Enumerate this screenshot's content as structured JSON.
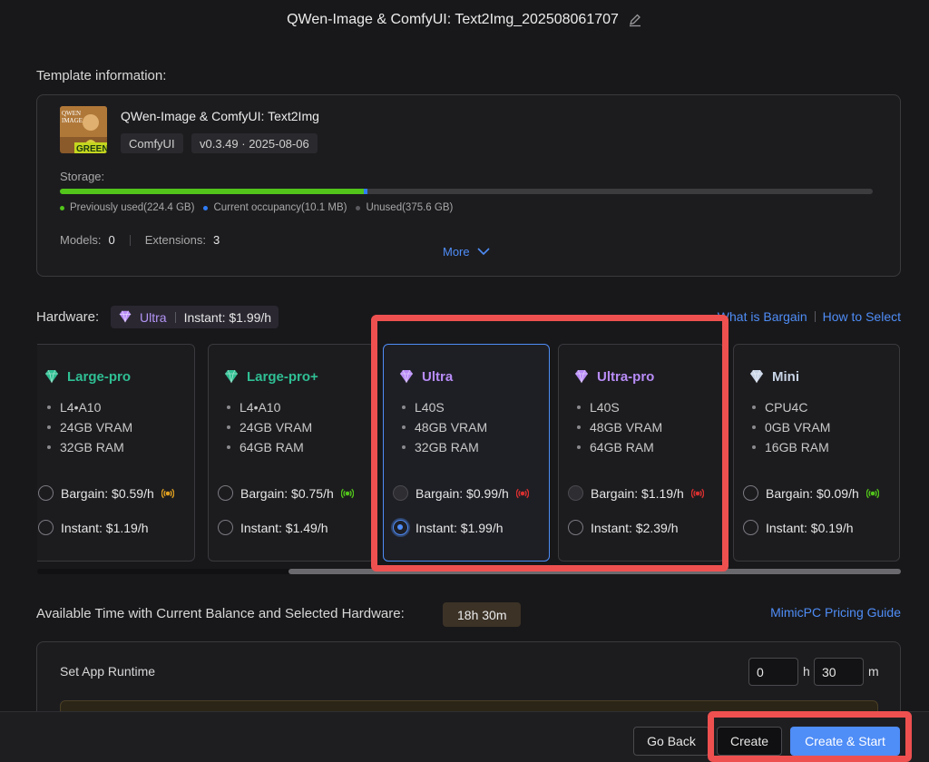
{
  "header": {
    "title": "QWen-Image & ComfyUI: Text2Img_202508061707",
    "edit_icon": "pencil-icon"
  },
  "template": {
    "label": "Template information:",
    "name": "QWen-Image & ComfyUI: Text2Img",
    "thumbnail_text": {
      "top": "QWEN\nIMAGE",
      "bottom": "GREEN"
    },
    "tags": [
      "ComfyUI",
      "v0.3.49 · 2025-08-06"
    ],
    "storage": {
      "label": "Storage:",
      "used_fraction": 0.3735,
      "current_fraction": 0.0017,
      "legend": [
        "Previously used(224.4 GB)",
        "Current occupancy(10.1 MB)",
        "Unused(375.6 GB)"
      ]
    },
    "models_label": "Models:",
    "models_count": "0",
    "extensions_label": "Extensions:",
    "extensions_count": "3",
    "more_label": "More"
  },
  "hardware": {
    "label": "Hardware:",
    "selected_tier": "Ultra",
    "selected_price": "Instant: $1.99/h",
    "links": [
      "What is Bargain",
      "How to Select"
    ],
    "cards": [
      {
        "name": "Large-pro",
        "color": "#2fbf92",
        "specs": [
          "L4•A10",
          "24GB VRAM",
          "32GB RAM"
        ],
        "bargain": "Bargain: $0.59/h",
        "instant": "Instant: $1.19/h",
        "signal": "#e0a020",
        "state": "normal"
      },
      {
        "name": "Large-pro+",
        "color": "#2fbf92",
        "specs": [
          "L4•A10",
          "24GB VRAM",
          "64GB RAM"
        ],
        "bargain": "Bargain: $0.75/h",
        "instant": "Instant: $1.49/h",
        "signal": "#52c41a",
        "state": "normal"
      },
      {
        "name": "Ultra",
        "color": "#b88cf7",
        "specs": [
          "L40S",
          "48GB VRAM",
          "32GB RAM"
        ],
        "bargain": "Bargain: $0.99/h",
        "instant": "Instant: $1.99/h",
        "signal": "#d93030",
        "state": "selected"
      },
      {
        "name": "Ultra-pro",
        "color": "#b88cf7",
        "specs": [
          "L40S",
          "48GB VRAM",
          "64GB RAM"
        ],
        "bargain": "Bargain: $1.19/h",
        "instant": "Instant: $2.39/h",
        "signal": "#d93030",
        "state": "normal"
      },
      {
        "name": "Mini",
        "color": "#c8d4e6",
        "specs": [
          "CPU4C",
          "0GB VRAM",
          "16GB RAM"
        ],
        "bargain": "Bargain: $0.09/h",
        "instant": "Instant: $0.19/h",
        "signal": "#52c41a",
        "state": "normal"
      }
    ]
  },
  "availability": {
    "label": "Available Time with Current Balance and Selected Hardware:",
    "value": "18h 30m",
    "pricing_link": "MimicPC Pricing Guide"
  },
  "runtime": {
    "label": "Set App Runtime",
    "hours": "0",
    "hours_unit": "h",
    "minutes": "30",
    "minutes_unit": "m"
  },
  "footer": {
    "back_label": "Go Back",
    "create_label": "Create",
    "start_label": "Create & Start"
  }
}
